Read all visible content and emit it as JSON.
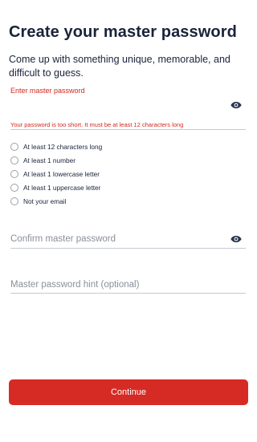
{
  "header": {
    "title": "Create your master password",
    "subtitle": "Come up with something unique, memorable, and difficult to guess."
  },
  "master_password": {
    "label": "Enter master password",
    "value": "",
    "error": "Your password is too short. It must be at least 12 characters long",
    "visibility_icon": "eye-icon"
  },
  "requirements": [
    {
      "label": "At least 12 characters long",
      "met": false
    },
    {
      "label": "At least 1 number",
      "met": false
    },
    {
      "label": "At least 1 lowercase letter",
      "met": false
    },
    {
      "label": "At least 1 uppercase letter",
      "met": false
    },
    {
      "label": "Not your email",
      "met": false
    }
  ],
  "confirm_password": {
    "placeholder": "Confirm master password",
    "value": "",
    "visibility_icon": "eye-icon"
  },
  "hint": {
    "placeholder": "Master password hint (optional)",
    "value": ""
  },
  "actions": {
    "continue_label": "Continue"
  },
  "colors": {
    "title": "#19233a",
    "error": "#d0281f",
    "primary_button": "#d62b25",
    "icon": "#2a3550"
  }
}
